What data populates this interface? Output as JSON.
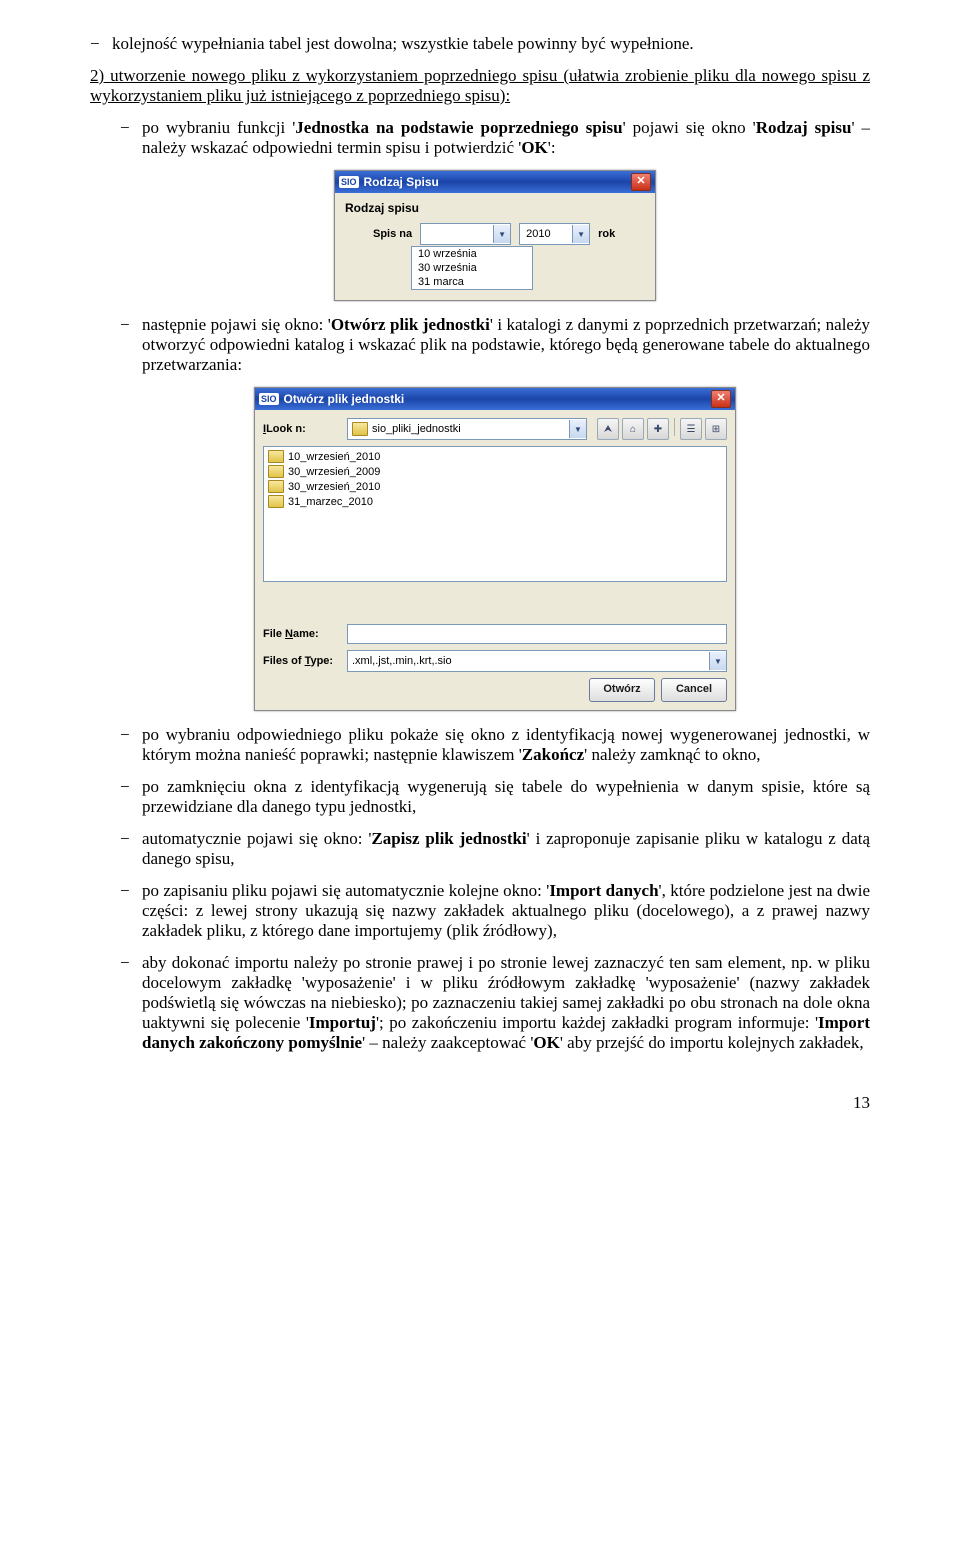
{
  "top_bullet": "kolejność wypełniania tabel jest dowolna; wszystkie tabele powinny być wypełnione.",
  "section2": {
    "prefix": "2) ",
    "underlined": "utworzenie nowego pliku z wykorzystaniem poprzedniego spisu",
    "tail": " (ułatwia zrobienie pliku dla nowego spisu z wykorzystaniem pliku już istniejącego z poprzedniego spisu):"
  },
  "sub1_before": "po wybraniu funkcji '",
  "sub1_bold": "Jednostka na podstawie poprzedniego spisu",
  "sub1_mid": "' pojawi się okno '",
  "sub1_bold2": "Rodzaj spisu",
  "sub1_after": "' – należy wskazać odpowiedni termin spisu i potwierdzić '",
  "sub1_bold3": "OK",
  "sub1_end": "':",
  "rodzaj_dialog": {
    "icon": "SIO",
    "title": "Rodzaj Spisu",
    "field_label": "Rodzaj spisu",
    "spis_label": "Spis na",
    "selected": "",
    "year": "2010",
    "year_suffix": "rok",
    "options": [
      "10 września",
      "30 września",
      "31 marca"
    ]
  },
  "sub2_before": "następnie pojawi się okno: '",
  "sub2_bold": "Otwórz plik jednostki",
  "sub2_after": "' i katalogi z danymi z poprzednich przetwarzań; należy otworzyć odpowiedni katalog i wskazać plik na podstawie, którego będą generowane tabele do aktualnego przetwarzania:",
  "open_dialog": {
    "icon": "SIO",
    "title": "Otwórz plik jednostki",
    "look_in_label": "Look In:",
    "look_in_value": "sio_pliki_jednostki",
    "folders": [
      "10_wrzesień_2010",
      "30_wrzesień_2009",
      "30_wrzesień_2010",
      "31_marzec_2010"
    ],
    "file_name_label_u": "N",
    "file_name_label": "File Name:",
    "file_name_value": "",
    "file_type_label_u": "T",
    "file_type_label": "Files of Type:",
    "file_type_value": ".xml,.jst,.min,.krt,.sio",
    "btn_open": "Otwórz",
    "btn_cancel": "Cancel"
  },
  "sub3_before": "po wybraniu odpowiedniego pliku pokaże się okno z identyfikacją nowej wygenerowanej jednostki, w którym można nanieść poprawki; następnie klawiszem '",
  "sub3_bold": "Zakończ",
  "sub3_after": "' należy zamknąć to okno,",
  "sub4": "po zamknięciu okna z identyfikacją wygenerują się tabele do wypełnienia w danym spisie, które są przewidziane dla danego typu jednostki,",
  "sub5_before": "automatycznie pojawi się okno: '",
  "sub5_bold": "Zapisz plik jednostki",
  "sub5_after": "' i zaproponuje zapisanie pliku w katalogu z datą danego spisu,",
  "sub6_before": "po zapisaniu pliku pojawi się automatycznie kolejne okno: '",
  "sub6_bold": "Import danych",
  "sub6_after": "', które podzielone jest na dwie części: z lewej strony ukazują się nazwy zakładek aktualnego pliku (docelowego), a z prawej nazwy zakładek pliku, z którego dane importujemy (plik źródłowy),",
  "sub7_before": "aby dokonać importu należy po stronie prawej i po stronie lewej zaznaczyć ten sam element, np. w pliku docelowym zakładkę 'wyposażenie' i w pliku źródłowym zakładkę 'wyposażenie' (nazwy zakładek podświetlą się wówczas na niebiesko); po zaznaczeniu takiej samej zakładki po obu stronach na dole okna uaktywni się polecenie '",
  "sub7_bold1": "Importuj",
  "sub7_mid": "'; po zakończeniu importu każdej zakładki program informuje: '",
  "sub7_bold2": "Import danych zakończony pomyślnie",
  "sub7_mid2": "' – należy zaakceptować '",
  "sub7_bold3": "OK",
  "sub7_end": "' aby przejść do importu kolejnych zakładek,",
  "page_number": "13",
  "icons": {
    "close": "✕",
    "down": "▼",
    "up": "⮝",
    "home": "⌂",
    "newfolder": "✚",
    "list": "☰",
    "details": "⊞"
  }
}
